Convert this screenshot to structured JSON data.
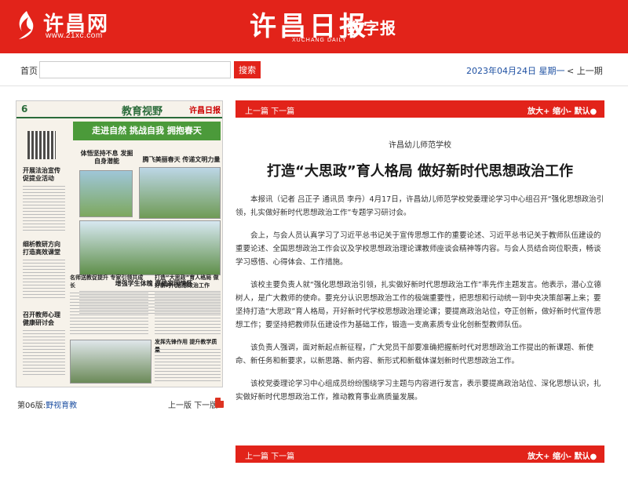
{
  "header": {
    "site_name": "许昌网",
    "site_url": "www.21xc.com",
    "paper_name": "许昌日报",
    "paper_english": "XUCHANG DAILY",
    "edition_label": "数字报",
    "bg_color": "#e2231a"
  },
  "toolbar": {
    "home_label": "首页",
    "search_placeholder": "",
    "search_button": "搜索",
    "date": "2023年04月24日 星期一",
    "prev_issue": "< 上一期"
  },
  "page": {
    "thumb": {
      "number": "6",
      "name": "教育视野",
      "logo": "许昌日报",
      "banner": "走进自然 挑战自我 拥抱春天",
      "headlines": [
        "开展法治宣传 促提业活动",
        "体悟坚持不息 发掘自身潜能",
        "腾飞美丽春天 传递文明力量",
        "增强学生体魄 厚植家国情怀",
        "细析教研方向 打造高效课堂",
        "名师送教促提升 专家引领共成长",
        "打造“大思政”育人格局 做好新时代思想政治工作",
        "召开教师心理 健康研讨会",
        "发挥先锋作用 提升教学质量"
      ]
    },
    "caption_label": "第06版:",
    "caption_name": "野视育教",
    "nav_text": "上一版 下一版"
  },
  "article": {
    "top_bar": {
      "prev_next": "上一篇 下一篇",
      "controls": "放大+ 缩小- 默认●"
    },
    "section": "许昌幼儿师范学校",
    "title": "打造“大思政”育人格局 做好新时代思想政治工作",
    "paragraphs": [
      "本报讯（记者 吕正子 通讯员 李丹）4月17日，许昌幼儿师范学校党委理论学习中心组召开“强化思想政治引领，扎实做好新时代思想政治工作”专题学习研讨会。",
      "会上，与会人员认真学习了习近平总书记关于宣传思想工作的重要论述、习近平总书记关于教师队伍建设的重要论述、全国思想政治工作会议及学校思想政治理论课教师座谈会精神等内容。与会人员结合岗位职责，畅谈学习感悟、心得体会、工作措施。",
      "该校主要负责人就“强化思想政治引领，扎实做好新时代思想政治工作”率先作主题发言。他表示，潜心立德树人，是广大教师的使命。要充分认识思想政治工作的极端重要性，把思想和行动统一到中央决策部署上来；要坚持打造“大思政”育人格局，开好新时代学校思想政治理论课；要提高政治站位，夺正创新，做好新时代宣传思想工作；要坚持把教师队伍建设作为基础工作，锻造一支高素质专业化创新型教师队伍。",
      "该负责人强调，面对新起点新征程，广大党员干部要准确把握新时代对思想政治工作提出的新课题、新使命、新任务和新要求，以新思路、新内容、新形式和新载体谋划新时代思想政治工作。",
      "该校党委理论学习中心组成员纷纷围绕学习主题与内容进行发言，表示要提高政治站位、深化思想认识，扎实做好新时代思想政治工作，推动教育事业高质量发展。"
    ],
    "bottom_bar": {
      "prev_next": "上一篇 下一篇",
      "controls": "放大+ 缩小- 默认●"
    }
  }
}
